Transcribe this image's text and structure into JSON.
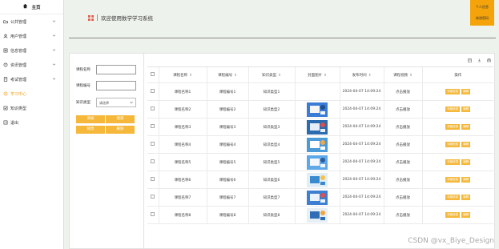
{
  "sidebar": {
    "home": "主页",
    "items": [
      {
        "label": "公共管理",
        "icon": "folder-icon",
        "chevron": true
      },
      {
        "label": "用户管理",
        "icon": "user-icon",
        "chevron": true
      },
      {
        "label": "信息管理",
        "icon": "info-icon",
        "chevron": true
      },
      {
        "label": "资讯管理",
        "icon": "news-icon",
        "chevron": true
      },
      {
        "label": "考试管理",
        "icon": "exam-icon",
        "chevron": true
      },
      {
        "label": "学习中心",
        "icon": "study-icon",
        "chevron": false,
        "active": true
      },
      {
        "label": "知识类型",
        "icon": "type-icon",
        "chevron": false
      },
      {
        "label": "退出",
        "icon": "logout-icon",
        "chevron": false
      }
    ]
  },
  "header": {
    "title": "欢迎使用数学学习系统",
    "btn_profile": "个人信息",
    "btn_password": "修改密码"
  },
  "search": {
    "course_name_label": "课程名称",
    "course_no_label": "课程编号",
    "type_label": "知识类型",
    "type_placeholder": "请选择",
    "btn_search": "搜索",
    "btn_add": "添加",
    "btn_edit": "修改",
    "btn_delete": "删除"
  },
  "table": {
    "columns": [
      "课程名称",
      "课程编号",
      "知识类型",
      "封面图片",
      "发布时间",
      "课程视频",
      "操作"
    ],
    "rows": [
      {
        "name": "课程名称1",
        "no": "课程编号1",
        "type": "知识类型1",
        "img": false,
        "time": "2024-04-07 14:09:24",
        "video": "点击播放"
      },
      {
        "name": "课程名称2",
        "no": "课程编号2",
        "type": "知识类型2",
        "img": true,
        "time": "2024-04-07 14:09:24",
        "video": "点击播放"
      },
      {
        "name": "课程名称3",
        "no": "课程编号3",
        "type": "知识类型3",
        "img": true,
        "time": "2024-04-07 14:09:24",
        "video": "点击播放"
      },
      {
        "name": "课程名称4",
        "no": "课程编号4",
        "type": "知识类型4",
        "img": true,
        "time": "2024-04-07 14:09:24",
        "video": "点击播放"
      },
      {
        "name": "课程名称5",
        "no": "课程编号5",
        "type": "知识类型5",
        "img": true,
        "time": "2024-04-07 14:09:24",
        "video": "点击播放"
      },
      {
        "name": "课程名称6",
        "no": "课程编号6",
        "type": "知识类型6",
        "img": true,
        "time": "2024-04-07 14:09:24",
        "video": "点击播放"
      },
      {
        "name": "课程名称7",
        "no": "课程编号7",
        "type": "知识类型7",
        "img": true,
        "time": "2024-04-07 14:09:24",
        "video": "点击播放"
      },
      {
        "name": "课程名称8",
        "no": "课程编号8",
        "type": "知识类型8",
        "img": true,
        "time": "2024-04-07 14:09:24",
        "video": "点击播放"
      }
    ],
    "op_detail": "详细信息",
    "op_edit": "编辑"
  },
  "watermark": "CSDN @vx_Biye_Design",
  "colors": {
    "accent": "#f5b83a",
    "header_btn": "#f5a30a",
    "active": "#f0a020"
  }
}
